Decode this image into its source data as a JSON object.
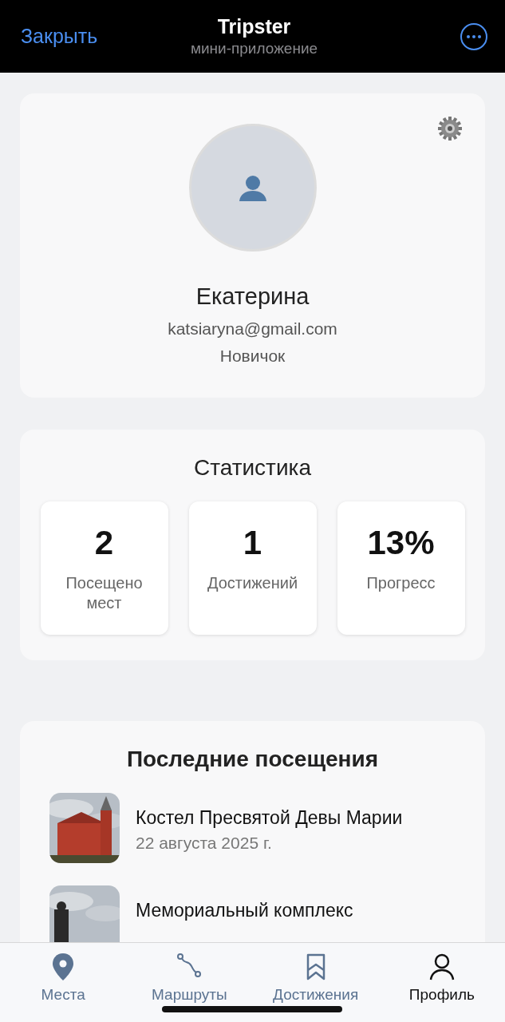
{
  "header": {
    "close": "Закрыть",
    "title": "Tripster",
    "subtitle": "мини-приложение"
  },
  "profile": {
    "name": "Екатерина",
    "email": "katsiaryna@gmail.com",
    "rank": "Новичок"
  },
  "stats": {
    "title": "Статистика",
    "items": [
      {
        "value": "2",
        "label": "Посещено мест"
      },
      {
        "value": "1",
        "label": "Достижений"
      },
      {
        "value": "13%",
        "label": "Прогресс"
      }
    ]
  },
  "recent": {
    "title": "Последние посещения",
    "items": [
      {
        "name": "Костел Пресвятой Девы Марии",
        "date": "22 августа 2025 г.",
        "kind": "church"
      },
      {
        "name": "Мемориальный комплекс",
        "kind": "memorial"
      }
    ]
  },
  "tabs": [
    {
      "label": "Места",
      "kind": "pin",
      "selected": false
    },
    {
      "label": "Маршруты",
      "kind": "route",
      "selected": false
    },
    {
      "label": "Достижения",
      "kind": "bookmark",
      "selected": false
    },
    {
      "label": "Профиль",
      "kind": "user",
      "selected": true
    }
  ]
}
